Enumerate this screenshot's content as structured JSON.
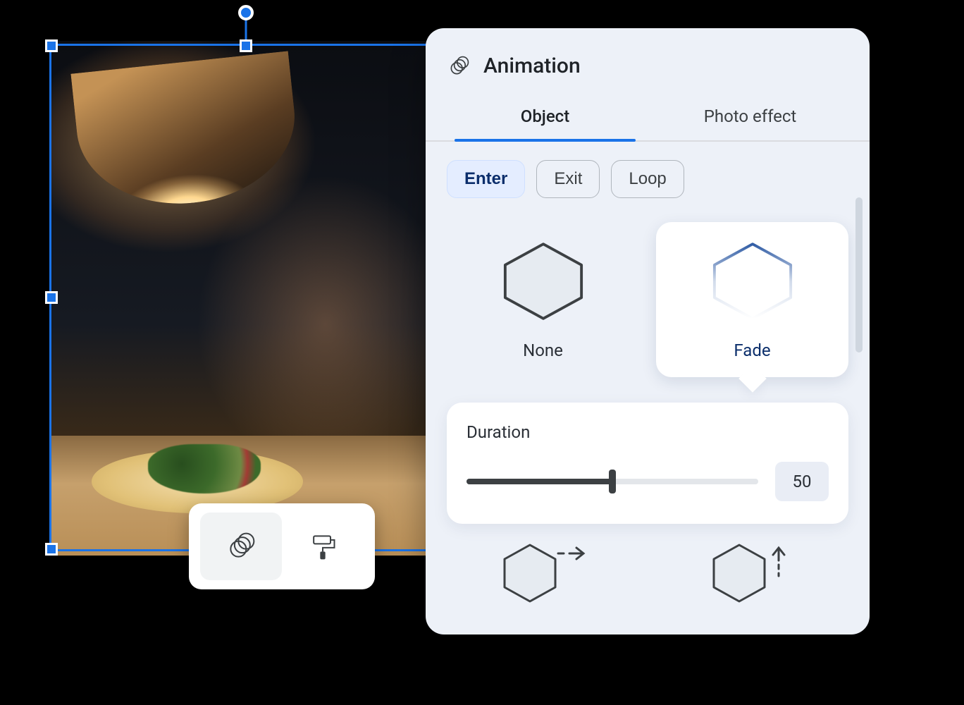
{
  "panel": {
    "title": "Animation",
    "tabs": [
      "Object",
      "Photo effect"
    ],
    "active_tab": 0,
    "phases": [
      "Enter",
      "Exit",
      "Loop"
    ],
    "active_phase": 0,
    "options": [
      {
        "id": "none",
        "label": "None"
      },
      {
        "id": "fade",
        "label": "Fade"
      }
    ],
    "selected_option": "fade",
    "duration": {
      "label": "Duration",
      "value": 50,
      "min": 0,
      "max": 100
    }
  },
  "mini_toolbar": {
    "buttons": [
      {
        "id": "animation",
        "name": "animation-icon",
        "active": true
      },
      {
        "id": "style",
        "name": "paint-roller-icon",
        "active": false
      }
    ]
  },
  "colors": {
    "accent": "#1a73e8",
    "panel_bg": "#edf1f8",
    "selected_text": "#0b2e6b"
  }
}
